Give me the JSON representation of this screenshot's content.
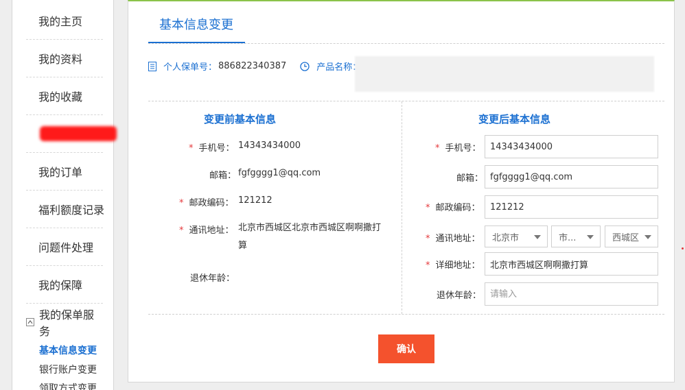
{
  "sidebar": {
    "items": [
      {
        "label": "我的主页"
      },
      {
        "label": "我的资料"
      },
      {
        "label": "我的收藏"
      },
      {
        "label": ""
      },
      {
        "label": "我的订单"
      },
      {
        "label": "福利额度记录"
      },
      {
        "label": "问题件处理"
      },
      {
        "label": "我的保障"
      }
    ],
    "group": {
      "label": "我的保单服务",
      "sub_items": [
        {
          "label": "基本信息变更",
          "active": true
        },
        {
          "label": "银行账户变更"
        },
        {
          "label": "领取方式变更"
        }
      ]
    }
  },
  "main": {
    "title": "基本信息变更",
    "policy_label": "个人保单号：",
    "policy_no": "886822340387",
    "product_label": "产品名称：",
    "before": {
      "heading": "变更前基本信息",
      "phone_label": "手机号：",
      "phone": "14343434000",
      "email_label": "邮箱：",
      "email": "fgfgggg1@qq.com",
      "zip_label": "邮政编码：",
      "zip": "121212",
      "address_label": "通讯地址：",
      "address": "北京市西城区北京市西城区啊啊撒打算",
      "retire_label": "退休年龄："
    },
    "after": {
      "heading": "变更后基本信息",
      "phone_label": "手机号：",
      "phone": "14343434000",
      "email_label": "邮箱：",
      "email": "fgfgggg1@qq.com",
      "zip_label": "邮政编码：",
      "zip": "121212",
      "address_label": "通讯地址：",
      "province": "北京市",
      "city": "市...",
      "district": "西城区",
      "detail_label": "详细地址：",
      "detail": "北京市西城区啊啊撒打算",
      "retire_label": "退休年龄：",
      "retire_placeholder": "请输入"
    },
    "confirm_label": "确认"
  },
  "colors": {
    "accent_blue": "#1a6fd1",
    "required_red": "#e5383b",
    "confirm_orange": "#f4522d",
    "panel_top_green": "#8bc34a"
  }
}
